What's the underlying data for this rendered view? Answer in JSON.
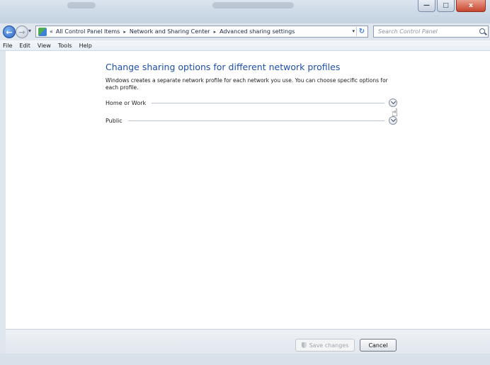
{
  "window": {
    "controls": {
      "minimize": "—",
      "maximize": "□",
      "close": "x"
    }
  },
  "nav": {
    "back_glyph": "←",
    "forward_glyph": "→",
    "recent_glyph": "▾",
    "address_overflow": "«",
    "breadcrumbs": [
      "All Control Panel Items",
      "Network and Sharing Center",
      "Advanced sharing settings"
    ],
    "separator": "▸",
    "refresh_glyph": "↻",
    "dropdown_glyph": "▾",
    "search_placeholder": "Search Control Panel"
  },
  "menu": [
    "File",
    "Edit",
    "View",
    "Tools",
    "Help"
  ],
  "main": {
    "title": "Change sharing options for different network profiles",
    "description": "Windows creates a separate network profile for each network you use. You can choose specific options for each profile.",
    "profiles": [
      {
        "label": "Home or Work",
        "expanded": false
      },
      {
        "label": "Public",
        "expanded": false
      }
    ]
  },
  "footer": {
    "save_label": "Save changes",
    "save_enabled": false,
    "cancel_label": "Cancel"
  },
  "icons": {
    "back": "back-arrow-icon",
    "forward": "forward-arrow-icon",
    "control_panel": "control-panel-icon",
    "refresh": "refresh-icon",
    "search": "search-icon",
    "expand": "chevron-down-icon",
    "shield": "shield-icon",
    "cursor": "hand-pointer-icon"
  },
  "colors": {
    "title_blue": "#1e4fa8",
    "close_red": "#c7452c"
  }
}
